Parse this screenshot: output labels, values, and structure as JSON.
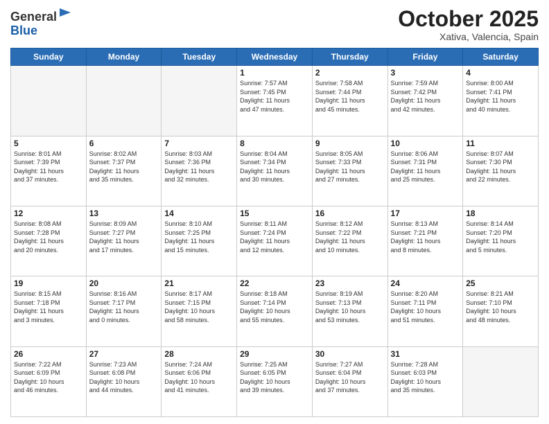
{
  "header": {
    "logo_general": "General",
    "logo_blue": "Blue",
    "month_title": "October 2025",
    "location": "Xativa, Valencia, Spain"
  },
  "days_of_week": [
    "Sunday",
    "Monday",
    "Tuesday",
    "Wednesday",
    "Thursday",
    "Friday",
    "Saturday"
  ],
  "weeks": [
    [
      {
        "day": "",
        "info": ""
      },
      {
        "day": "",
        "info": ""
      },
      {
        "day": "",
        "info": ""
      },
      {
        "day": "1",
        "info": "Sunrise: 7:57 AM\nSunset: 7:45 PM\nDaylight: 11 hours\nand 47 minutes."
      },
      {
        "day": "2",
        "info": "Sunrise: 7:58 AM\nSunset: 7:44 PM\nDaylight: 11 hours\nand 45 minutes."
      },
      {
        "day": "3",
        "info": "Sunrise: 7:59 AM\nSunset: 7:42 PM\nDaylight: 11 hours\nand 42 minutes."
      },
      {
        "day": "4",
        "info": "Sunrise: 8:00 AM\nSunset: 7:41 PM\nDaylight: 11 hours\nand 40 minutes."
      }
    ],
    [
      {
        "day": "5",
        "info": "Sunrise: 8:01 AM\nSunset: 7:39 PM\nDaylight: 11 hours\nand 37 minutes."
      },
      {
        "day": "6",
        "info": "Sunrise: 8:02 AM\nSunset: 7:37 PM\nDaylight: 11 hours\nand 35 minutes."
      },
      {
        "day": "7",
        "info": "Sunrise: 8:03 AM\nSunset: 7:36 PM\nDaylight: 11 hours\nand 32 minutes."
      },
      {
        "day": "8",
        "info": "Sunrise: 8:04 AM\nSunset: 7:34 PM\nDaylight: 11 hours\nand 30 minutes."
      },
      {
        "day": "9",
        "info": "Sunrise: 8:05 AM\nSunset: 7:33 PM\nDaylight: 11 hours\nand 27 minutes."
      },
      {
        "day": "10",
        "info": "Sunrise: 8:06 AM\nSunset: 7:31 PM\nDaylight: 11 hours\nand 25 minutes."
      },
      {
        "day": "11",
        "info": "Sunrise: 8:07 AM\nSunset: 7:30 PM\nDaylight: 11 hours\nand 22 minutes."
      }
    ],
    [
      {
        "day": "12",
        "info": "Sunrise: 8:08 AM\nSunset: 7:28 PM\nDaylight: 11 hours\nand 20 minutes."
      },
      {
        "day": "13",
        "info": "Sunrise: 8:09 AM\nSunset: 7:27 PM\nDaylight: 11 hours\nand 17 minutes."
      },
      {
        "day": "14",
        "info": "Sunrise: 8:10 AM\nSunset: 7:25 PM\nDaylight: 11 hours\nand 15 minutes."
      },
      {
        "day": "15",
        "info": "Sunrise: 8:11 AM\nSunset: 7:24 PM\nDaylight: 11 hours\nand 12 minutes."
      },
      {
        "day": "16",
        "info": "Sunrise: 8:12 AM\nSunset: 7:22 PM\nDaylight: 11 hours\nand 10 minutes."
      },
      {
        "day": "17",
        "info": "Sunrise: 8:13 AM\nSunset: 7:21 PM\nDaylight: 11 hours\nand 8 minutes."
      },
      {
        "day": "18",
        "info": "Sunrise: 8:14 AM\nSunset: 7:20 PM\nDaylight: 11 hours\nand 5 minutes."
      }
    ],
    [
      {
        "day": "19",
        "info": "Sunrise: 8:15 AM\nSunset: 7:18 PM\nDaylight: 11 hours\nand 3 minutes."
      },
      {
        "day": "20",
        "info": "Sunrise: 8:16 AM\nSunset: 7:17 PM\nDaylight: 11 hours\nand 0 minutes."
      },
      {
        "day": "21",
        "info": "Sunrise: 8:17 AM\nSunset: 7:15 PM\nDaylight: 10 hours\nand 58 minutes."
      },
      {
        "day": "22",
        "info": "Sunrise: 8:18 AM\nSunset: 7:14 PM\nDaylight: 10 hours\nand 55 minutes."
      },
      {
        "day": "23",
        "info": "Sunrise: 8:19 AM\nSunset: 7:13 PM\nDaylight: 10 hours\nand 53 minutes."
      },
      {
        "day": "24",
        "info": "Sunrise: 8:20 AM\nSunset: 7:11 PM\nDaylight: 10 hours\nand 51 minutes."
      },
      {
        "day": "25",
        "info": "Sunrise: 8:21 AM\nSunset: 7:10 PM\nDaylight: 10 hours\nand 48 minutes."
      }
    ],
    [
      {
        "day": "26",
        "info": "Sunrise: 7:22 AM\nSunset: 6:09 PM\nDaylight: 10 hours\nand 46 minutes."
      },
      {
        "day": "27",
        "info": "Sunrise: 7:23 AM\nSunset: 6:08 PM\nDaylight: 10 hours\nand 44 minutes."
      },
      {
        "day": "28",
        "info": "Sunrise: 7:24 AM\nSunset: 6:06 PM\nDaylight: 10 hours\nand 41 minutes."
      },
      {
        "day": "29",
        "info": "Sunrise: 7:25 AM\nSunset: 6:05 PM\nDaylight: 10 hours\nand 39 minutes."
      },
      {
        "day": "30",
        "info": "Sunrise: 7:27 AM\nSunset: 6:04 PM\nDaylight: 10 hours\nand 37 minutes."
      },
      {
        "day": "31",
        "info": "Sunrise: 7:28 AM\nSunset: 6:03 PM\nDaylight: 10 hours\nand 35 minutes."
      },
      {
        "day": "",
        "info": ""
      }
    ]
  ]
}
